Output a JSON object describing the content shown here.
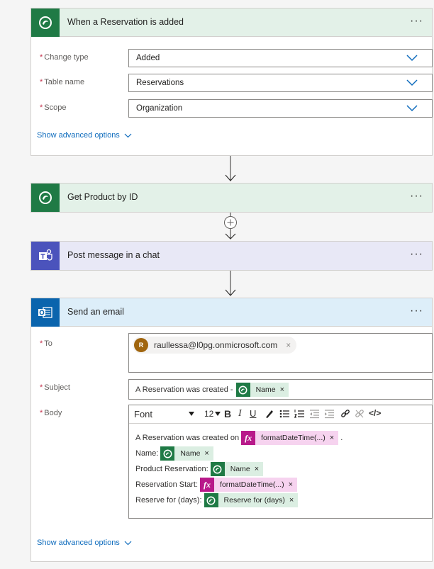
{
  "cards": {
    "trigger": {
      "title": "When a Reservation is added",
      "more": "···",
      "fields": [
        {
          "label": "Change type",
          "value": "Added"
        },
        {
          "label": "Table name",
          "value": "Reservations"
        },
        {
          "label": "Scope",
          "value": "Organization"
        }
      ],
      "advanced": "Show advanced options"
    },
    "get_product": {
      "title": "Get Product by ID",
      "more": "···"
    },
    "post_message": {
      "title": "Post message in a chat",
      "more": "···"
    },
    "send_email": {
      "title": "Send an email",
      "more": "···",
      "to_label": "To",
      "to_avatar": "R",
      "to_value": "raullessa@l0pg.onmicrosoft.com",
      "subject_label": "Subject",
      "subject_prefix": "A Reservation was created -",
      "subject_token": "Name",
      "body_label": "Body",
      "toolbar": {
        "font": "Font",
        "size": "12",
        "bold": "B",
        "italic": "I",
        "underline": "U",
        "code": "</>"
      },
      "body_lines": [
        {
          "text": "A Reservation was created on",
          "token": "formatDateTime(...)",
          "kind": "fx",
          "suffix": "."
        },
        {
          "text": "Name:",
          "token": "Name",
          "kind": "dv"
        },
        {
          "text": "Product Reservation:",
          "token": "Name",
          "kind": "dv"
        },
        {
          "text": "Reservation Start:",
          "token": "formatDateTime(...)",
          "kind": "fx"
        },
        {
          "text": "Reserve for (days):",
          "token": "Reserve for (days)",
          "kind": "dv"
        }
      ],
      "advanced": "Show advanced options"
    }
  },
  "glyphs": {
    "req": "*",
    "remove": "×",
    "fx": "fx"
  },
  "colors": {
    "dataverse": "#1f7a45",
    "teams": "#4b53bc",
    "outlook": "#0a64ad",
    "link": "#0f6cbd"
  }
}
